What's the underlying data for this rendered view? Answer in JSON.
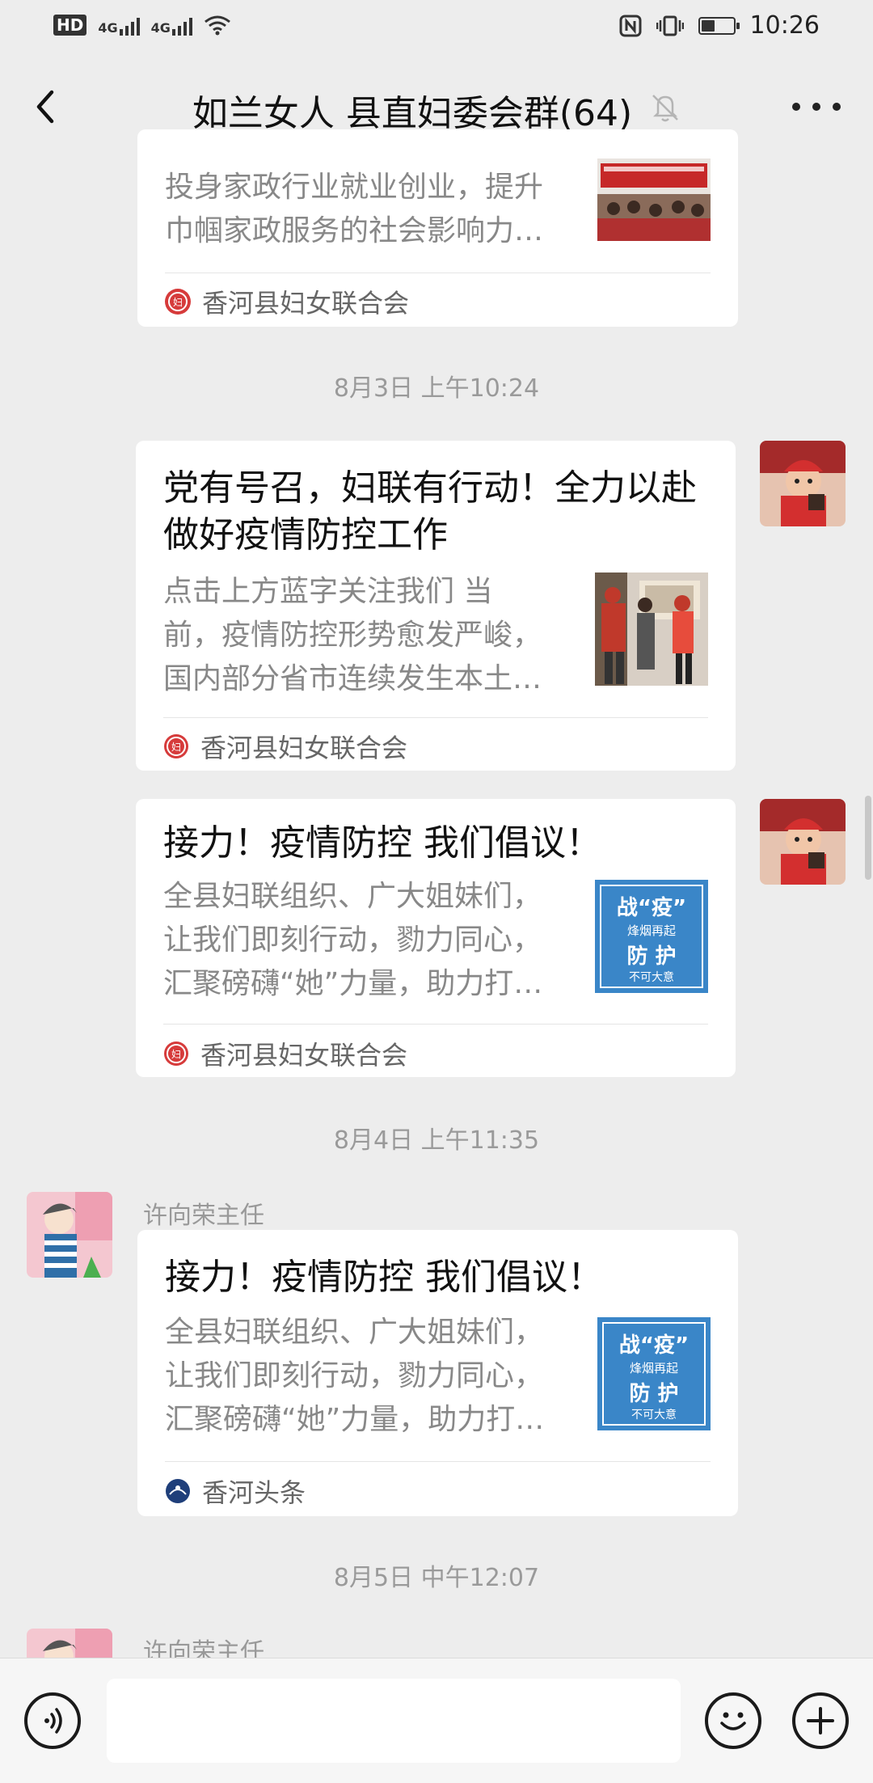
{
  "status_bar": {
    "network_left": "HD",
    "sig1": "4G",
    "sig2": "4G",
    "time": "10:26"
  },
  "nav": {
    "title": "如兰女人 县直妇委会群(64)"
  },
  "messages": [
    {
      "type": "article",
      "desc": "投身家政行业就业创业，提升巾帼家政服务的社会影响力…",
      "desc_lines": [
        "投身家政行业就业创业，提升",
        "巾帼家政服务的社会影响力…"
      ],
      "source": "香河县妇女联合会"
    },
    {
      "type": "timestamp",
      "text": "8月3日 上午10:24"
    },
    {
      "type": "article",
      "title_lines": [
        "党有号召，妇联有行动！全力以赴",
        "做好疫情防控工作"
      ],
      "desc_lines": [
        "点击上方蓝字关注我们     当",
        "前，疫情防控形势愈发严峻，",
        "国内部分省市连续发生本土…"
      ],
      "source": "香河县妇女联合会"
    },
    {
      "type": "article",
      "title_lines": [
        "接力！疫情防控 我们倡议！"
      ],
      "desc_lines": [
        "全县妇联组织、广大姐妹们，",
        "让我们即刻行动，勠力同心，",
        "汇聚磅礴“她”力量，助力打…"
      ],
      "source": "香河县妇女联合会",
      "thumb": {
        "t1": "战",
        "t2": "“疫”",
        "t3": "烽烟再起",
        "t4": "防 护",
        "t5": "不可大意"
      }
    },
    {
      "type": "timestamp",
      "text": "8月4日 上午11:35"
    },
    {
      "type": "article",
      "sender": "许向荣主任",
      "title_lines": [
        "接力！疫情防控 我们倡议！"
      ],
      "desc_lines": [
        "全县妇联组织、广大姐妹们，",
        "让我们即刻行动，勠力同心，",
        "汇聚磅礴“她”力量，助力打…"
      ],
      "source": "香河头条",
      "thumb": {
        "t1": "战",
        "t2": "“疫”",
        "t3": "烽烟再起",
        "t4": "防 护",
        "t5": "不可大意"
      }
    },
    {
      "type": "timestamp",
      "text": "8月5日 中午12:07"
    },
    {
      "type": "partial",
      "sender": "许向荣主任"
    }
  ],
  "input": {
    "value": ""
  },
  "colors": {
    "background": "#ededed",
    "card": "#ffffff",
    "fulian_red": "#d63b3b",
    "thumb_blue": "#3a86c8"
  }
}
